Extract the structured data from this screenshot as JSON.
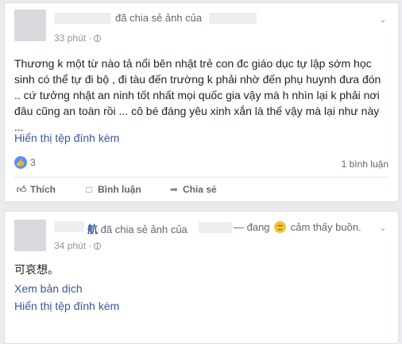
{
  "post1": {
    "shared_text": "đã chia sẻ ảnh của",
    "time": "33 phút",
    "body_lines": [
      "Thương k một từ nào tả nổi bên nhật trẻ con đc giáo dục tự lập sớm học",
      "sinh có thể tự đi bộ , đi tàu đến trường k phải nhờ đến phụ huynh đưa đón",
      ".. cứ tưởng nhật an ninh tốt nhất mọi quốc gia vậy mà h nhìn lại k phải nơi",
      "đâu cũng an toàn rồi ... cô bé đáng yêu xinh xắn là thế vậy mà lại như này",
      "..."
    ],
    "attachment_link": "Hiển thị tệp đính kèm",
    "like_icon": "thumbs-up-icon",
    "like_count": "3",
    "comment_count": "1 bình luận",
    "actions": {
      "like": "Thích",
      "comment": "Bình luận",
      "share": "Chia sẻ"
    }
  },
  "post2": {
    "name_fragment": "航",
    "shared_text": "đã chia sẻ ảnh của",
    "feeling_prefix": "— đang",
    "feeling_emoji": "sad-face-icon",
    "feeling_text": "cảm thấy buồn.",
    "time": "34 phút",
    "body": "可哀想。",
    "translate_link": "Xem bản dịch",
    "attachment_link": "Hiển thị tệp đính kèm"
  },
  "colors": {
    "link": "#365899",
    "meta": "#90949c",
    "like_blue": "#5890ff",
    "background": "#e9ebee"
  }
}
